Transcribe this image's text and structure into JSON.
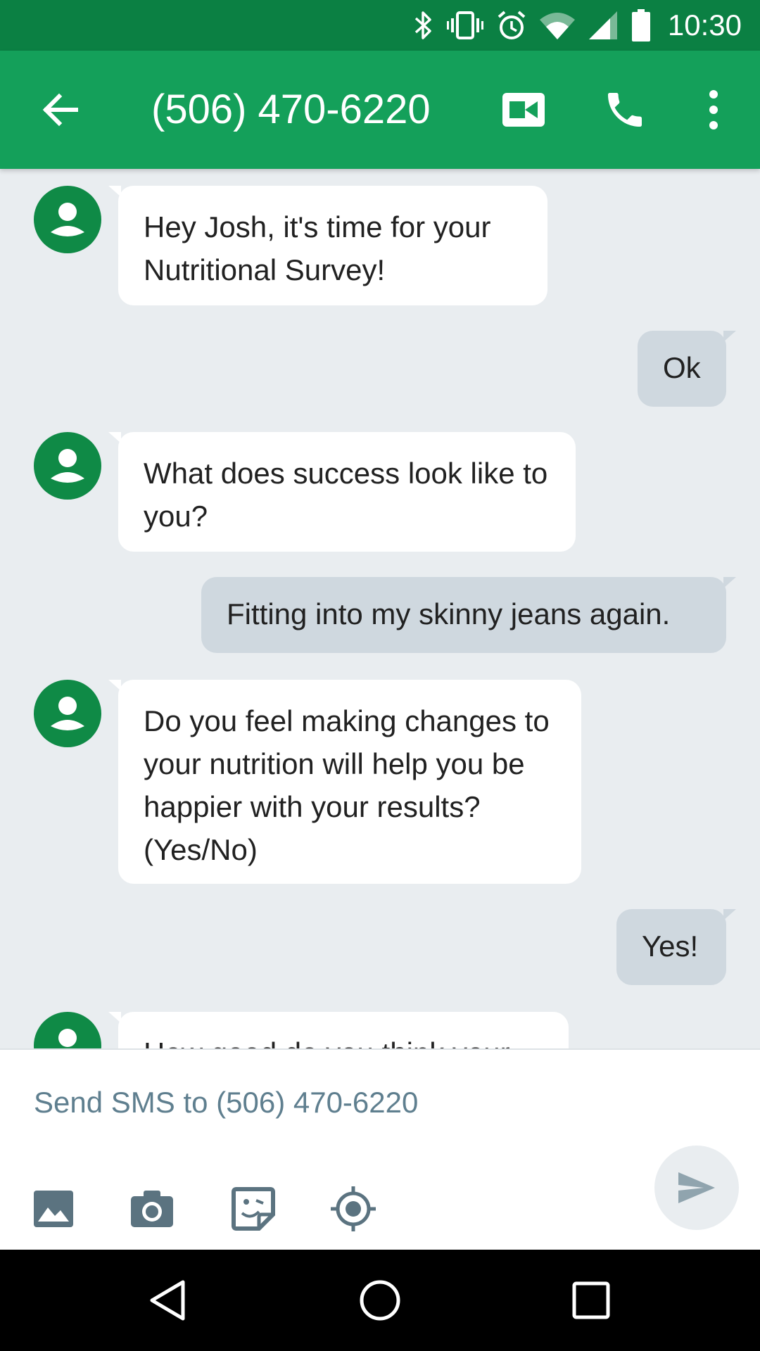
{
  "status_bar": {
    "time": "10:30",
    "icons": [
      "bluetooth-icon",
      "vibrate-icon",
      "alarm-icon",
      "wifi-icon",
      "signal-icon",
      "battery-icon"
    ]
  },
  "app_bar": {
    "title": "(506) 470-6220",
    "icons": [
      "back-arrow-icon",
      "video-call-icon",
      "phone-icon",
      "more-vert-icon"
    ]
  },
  "messages": [
    {
      "direction": "incoming",
      "text": "Hey Josh, it's time for your Nutritional Survey!"
    },
    {
      "direction": "outgoing",
      "text": "Ok"
    },
    {
      "direction": "incoming",
      "text": "What does success look like to you?"
    },
    {
      "direction": "outgoing",
      "text": "Fitting into my skinny jeans again."
    },
    {
      "direction": "incoming",
      "text": "Do you feel making changes to your nutrition will help you be happier with your results? (Yes/No)"
    },
    {
      "direction": "outgoing",
      "text": "Yes!"
    },
    {
      "direction": "incoming",
      "text": "How good do you think your"
    }
  ],
  "compose": {
    "placeholder": "Send SMS to (506) 470-6220",
    "tools": [
      "image-icon",
      "camera-icon",
      "sticker-icon",
      "location-icon",
      "send-icon"
    ]
  },
  "nav_bar": {
    "buttons": [
      "back-triangle-icon",
      "home-circle-icon",
      "recents-square-icon"
    ]
  },
  "colors": {
    "status_bar": "#0b8043",
    "app_bar": "#14a05a",
    "avatar": "#0f8a46",
    "background": "#e9edf0",
    "outgoing_bubble": "#cfd8df",
    "incoming_bubble": "#ffffff",
    "compose_text": "#5f7f8f"
  }
}
